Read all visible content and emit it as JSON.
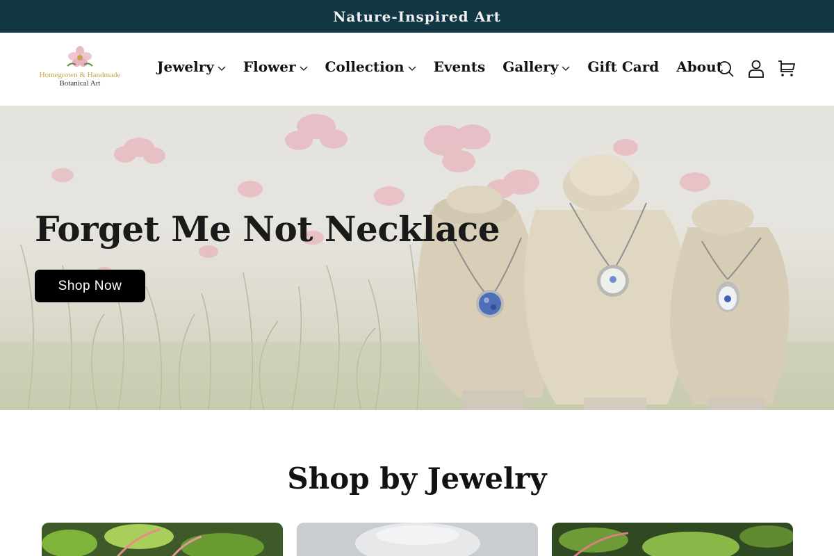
{
  "announcement": {
    "text": "Nature-Inspired Art"
  },
  "logo": {
    "line1": "Homegrown & Handmade",
    "line2": "Botanical Art"
  },
  "nav": {
    "items": [
      {
        "label": "Jewelry",
        "dropdown": true
      },
      {
        "label": "Flower",
        "dropdown": true
      },
      {
        "label": "Collection",
        "dropdown": true
      },
      {
        "label": "Events",
        "dropdown": false
      },
      {
        "label": "Gallery",
        "dropdown": true
      },
      {
        "label": "Gift Card",
        "dropdown": false
      },
      {
        "label": "About",
        "dropdown": false
      }
    ]
  },
  "header_icons": [
    "search-icon",
    "account-icon",
    "cart-icon"
  ],
  "hero": {
    "title": "Forget Me Not Necklace",
    "button_label": "Shop Now"
  },
  "section": {
    "title": "Shop by Jewelry",
    "cards": [
      "card-1",
      "card-2",
      "card-3"
    ]
  },
  "colors": {
    "announcement_bg": "#113644",
    "button_bg": "#000000",
    "text": "#121212"
  }
}
